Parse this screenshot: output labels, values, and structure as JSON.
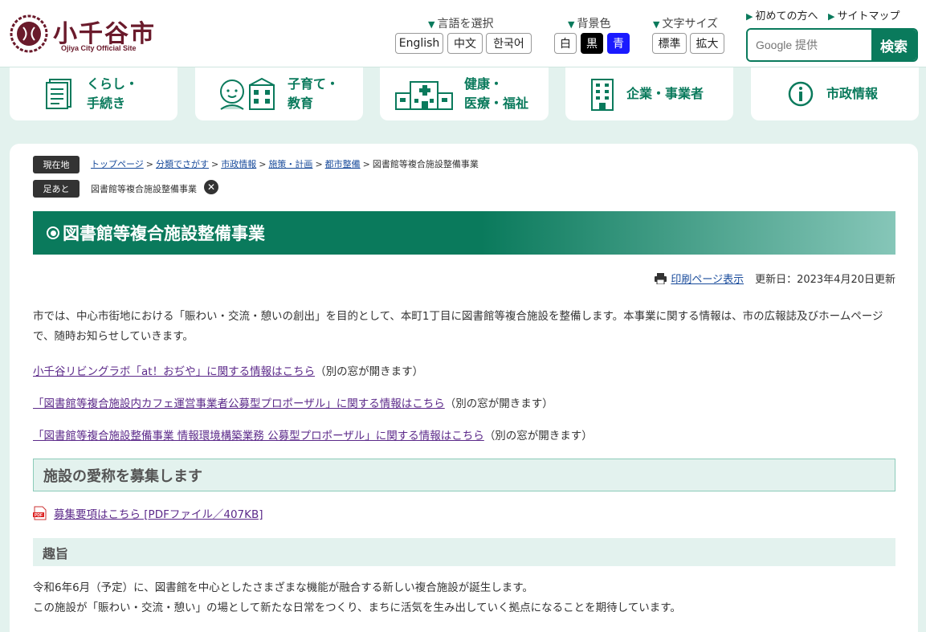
{
  "header": {
    "logo_title": "小千谷市",
    "logo_sub": "Ojiya City Official Site",
    "language_label": "言語を選択",
    "languages": [
      "English",
      "中文",
      "한국어"
    ],
    "bgcolor_label": "背景色",
    "bgcolors": [
      "白",
      "黒",
      "青"
    ],
    "fontsize_label": "文字サイズ",
    "fontsizes": [
      "標準",
      "拡大"
    ],
    "first_time_link": "初めての方へ",
    "sitemap_link": "サイトマップ",
    "search_placeholder": "Google 提供",
    "search_button": "検索"
  },
  "nav": [
    {
      "label": "くらし・\n手続き",
      "icon": "document-icon"
    },
    {
      "label": "子育て・\n教育",
      "icon": "child-school-icon"
    },
    {
      "label": "健康・\n医療・福祉",
      "icon": "hospital-icon"
    },
    {
      "label": "企業・事業者",
      "icon": "office-building-icon"
    },
    {
      "label": "市政情報",
      "icon": "info-icon"
    }
  ],
  "breadcrumb": {
    "current_tag": "現在地",
    "items": [
      "トップページ",
      "分類でさがす",
      "市政情報",
      "施策・計画",
      "都市整備"
    ],
    "current": "図書館等複合施設整備事業",
    "footprint_tag": "足あと",
    "footprint_item": "図書館等複合施設整備事業"
  },
  "page": {
    "title": "図書館等複合施設整備事業",
    "print_link": "印刷ページ表示",
    "updated": "更新日：2023年4月20日更新",
    "intro": "市では、中心市街地における「賑わい・交流・憩いの創出」を目的として、本町1丁目に図書館等複合施設を整備します。本事業に関する情報は、市の広報誌及びホームページで、随時お知らせしていきます。",
    "links": [
      {
        "text": "小千谷リビングラボ「at！おぢや」に関する情報はこちら",
        "note": "（別の窓が開きます）"
      },
      {
        "text": "「図書館等複合施設内カフェ運営事業者公募型プロポーザル」に関する情報はこちら",
        "note": "（別の窓が開きます）"
      },
      {
        "text": "「図書館等複合施設整備事業 情報環境構築業務 公募型プロポーザル」に関する情報はこちら",
        "note": "（別の窓が開きます）"
      }
    ],
    "section1_heading": "施設の愛称を募集します",
    "pdf_link": "募集要項はこちら [PDFファイル／407KB]",
    "section2_heading": "趣旨",
    "purpose_line1": "令和6年6月（予定）に、図書館を中心としたさまざまな機能が融合する新しい複合施設が誕生します。",
    "purpose_line2": "この施設が「賑わい・交流・憩い」の場として新たな日常をつくり、まちに活気を生み出していく拠点になることを期待しています。"
  },
  "colors": {
    "brand_green": "#0a7a5c",
    "logo_maroon": "#6a1a2b",
    "page_bg": "#e3f2ee",
    "link_purple": "#5c2a8a"
  }
}
